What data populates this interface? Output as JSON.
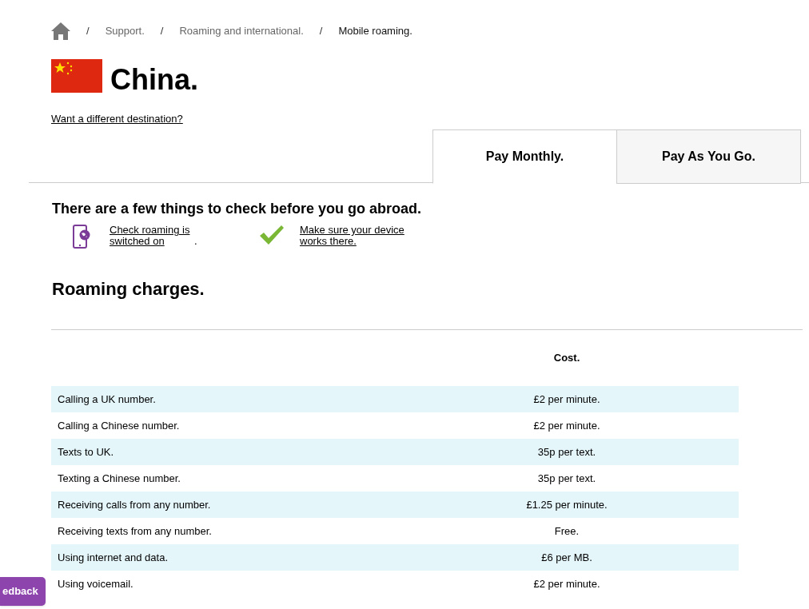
{
  "breadcrumb": [
    {
      "label": "Support.",
      "current": false
    },
    {
      "label": "Roaming and international.",
      "current": false
    },
    {
      "label": "Mobile roaming.",
      "current": true
    }
  ],
  "breadcrumb_separator": "/",
  "title": "China.",
  "change_destination": "Want a different destination?",
  "tabs": [
    {
      "label": "Pay Monthly.",
      "selected": true
    },
    {
      "label": "Pay As You Go.",
      "selected": false
    }
  ],
  "checks": {
    "heading": "There are a few things to check before you go abroad.",
    "items": [
      {
        "kind": "phone",
        "link": "Check roaming is switched on",
        "after": "."
      },
      {
        "kind": "tick",
        "link": "Make sure your device works there."
      }
    ]
  },
  "charges": {
    "heading": "Roaming charges.",
    "columns": [
      "Cost."
    ],
    "rows": [
      {
        "item": "Calling a UK number.",
        "cost": "£2 per minute."
      },
      {
        "item": "Calling a Chinese number.",
        "cost": "£2 per minute."
      },
      {
        "item": "Texts to UK.",
        "cost": "35p per text."
      },
      {
        "item": "Texting a Chinese number.",
        "cost": "35p per text."
      },
      {
        "item": "Receiving calls from any number.",
        "cost": "£1.25 per minute."
      },
      {
        "item": "Receiving texts from any number.",
        "cost": "Free."
      },
      {
        "item": "Using internet and data.",
        "cost": "£6 per MB."
      },
      {
        "item": "Using voicemail.",
        "cost": "£2 per minute."
      }
    ]
  },
  "feedback_button": "edback"
}
